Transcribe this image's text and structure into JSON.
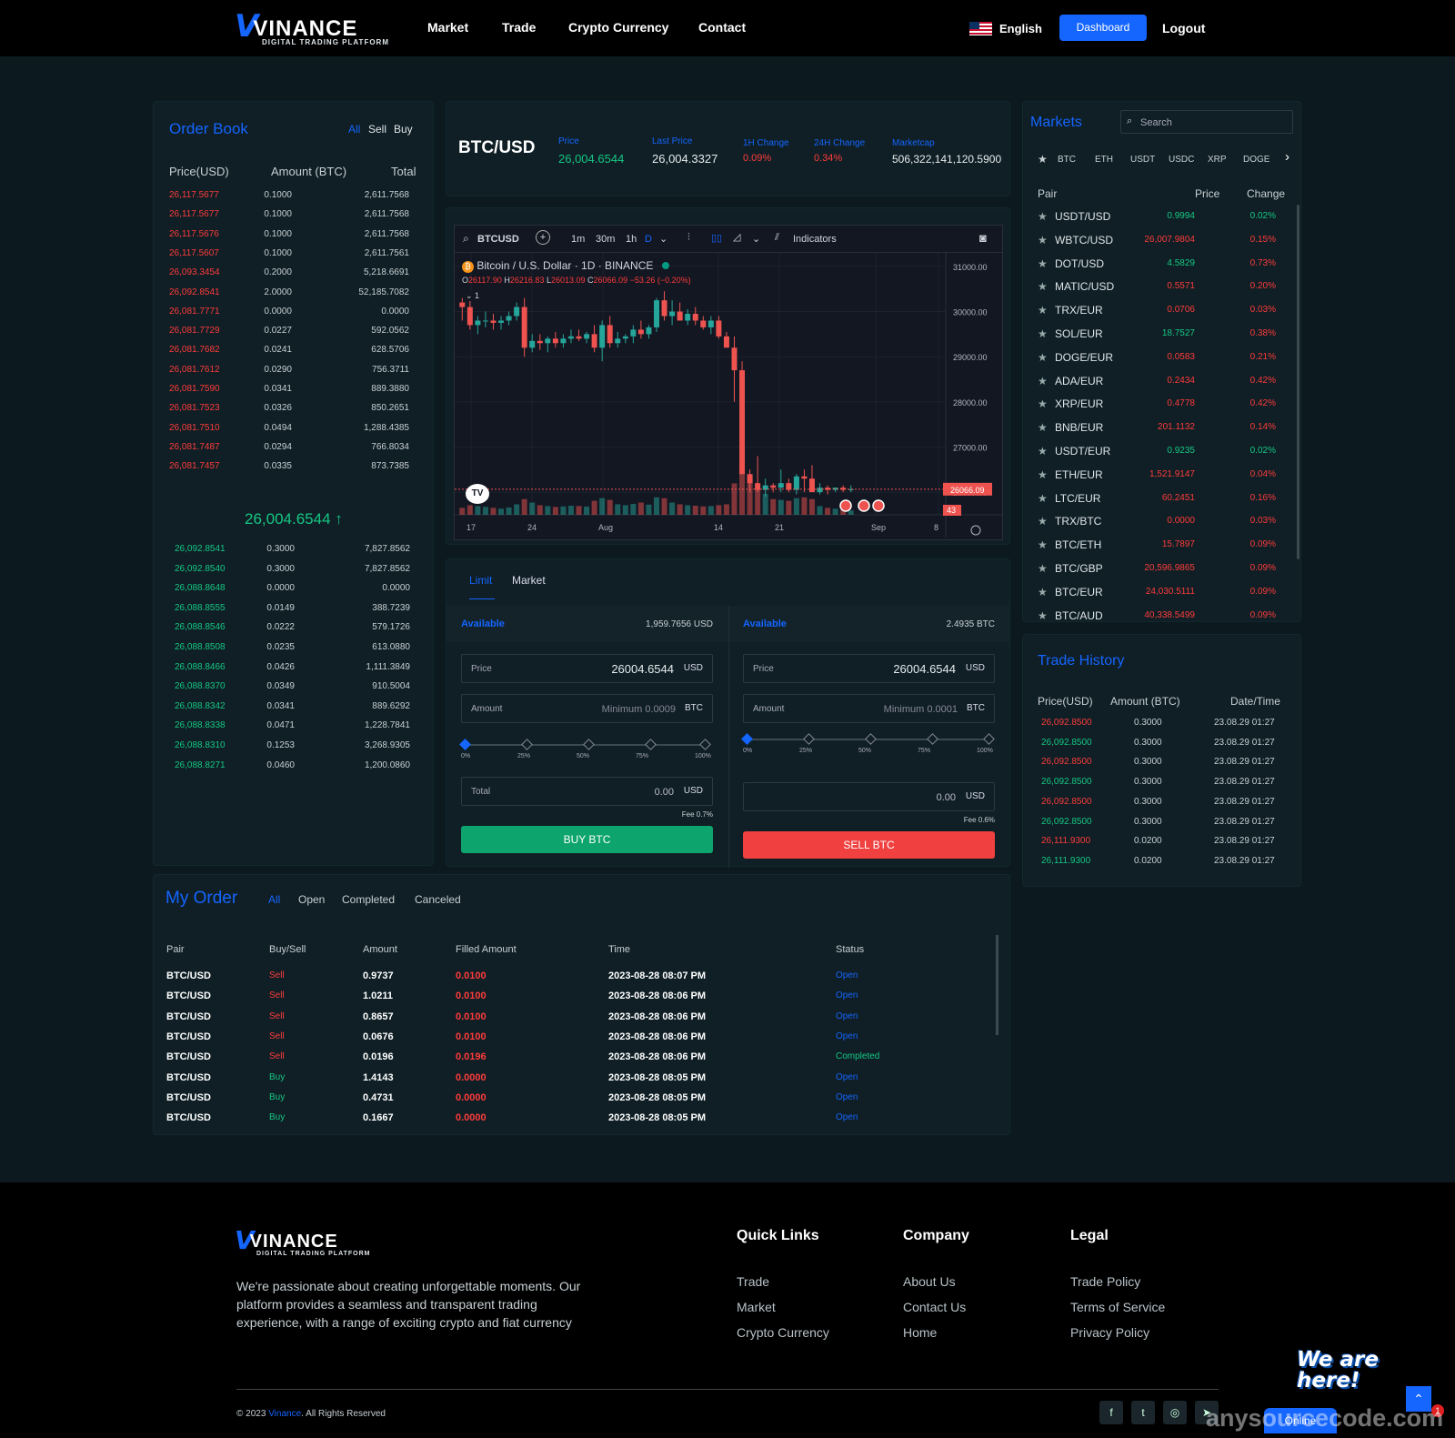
{
  "header": {
    "brand": "VINANCE",
    "brand_v": "V",
    "brand_tag": "DIGITAL TRADING PLATFORM",
    "nav": [
      "Market",
      "Trade",
      "Crypto Currency",
      "Contact"
    ],
    "language": "English",
    "dashboard": "Dashboard",
    "logout": "Logout"
  },
  "orderbook": {
    "title": "Order Book",
    "filters": [
      "All",
      "Sell",
      "Buy"
    ],
    "cols": [
      "Price(USD)",
      "Amount (BTC)",
      "Total"
    ],
    "sells": [
      [
        "26,117.5677",
        "0.1000",
        "2,611.7568"
      ],
      [
        "26,117.5677",
        "0.1000",
        "2,611.7568"
      ],
      [
        "26,117.5676",
        "0.1000",
        "2,611.7568"
      ],
      [
        "26,117.5607",
        "0.1000",
        "2,611.7561"
      ],
      [
        "26,093.3454",
        "0.2000",
        "5,218.6691"
      ],
      [
        "26,092.8541",
        "2.0000",
        "52,185.7082"
      ],
      [
        "26,081.7771",
        "0.0000",
        "0.0000"
      ],
      [
        "26,081.7729",
        "0.0227",
        "592.0562"
      ],
      [
        "26,081.7682",
        "0.0241",
        "628.5706"
      ],
      [
        "26,081.7612",
        "0.0290",
        "756.3711"
      ],
      [
        "26,081.7590",
        "0.0341",
        "889.3880"
      ],
      [
        "26,081.7523",
        "0.0326",
        "850.2651"
      ],
      [
        "26,081.7510",
        "0.0494",
        "1,288.4385"
      ],
      [
        "26,081.7487",
        "0.0294",
        "766.8034"
      ],
      [
        "26,081.7457",
        "0.0335",
        "873.7385"
      ]
    ],
    "mid": "26,004.6544",
    "buys": [
      [
        "26,092.8541",
        "0.3000",
        "7,827.8562"
      ],
      [
        "26,092.8540",
        "0.3000",
        "7,827.8562"
      ],
      [
        "26,088.8648",
        "0.0000",
        "0.0000"
      ],
      [
        "26,088.8555",
        "0.0149",
        "388.7239"
      ],
      [
        "26,088.8546",
        "0.0222",
        "579.1726"
      ],
      [
        "26,088.8508",
        "0.0235",
        "613.0880"
      ],
      [
        "26,088.8466",
        "0.0426",
        "1,111.3849"
      ],
      [
        "26,088.8370",
        "0.0349",
        "910.5004"
      ],
      [
        "26,088.8342",
        "0.0341",
        "889.6292"
      ],
      [
        "26,088.8338",
        "0.0471",
        "1,228.7841"
      ],
      [
        "26,088.8310",
        "0.1253",
        "3,268.9305"
      ],
      [
        "26,088.8271",
        "0.0460",
        "1,200.0860"
      ]
    ]
  },
  "ticker": {
    "pair": "BTC/USD",
    "price_label": "Price",
    "price": "26,004.6544",
    "last_label": "Last Price",
    "last": "26,004.3327",
    "h1_label": "1H Change",
    "h1": "0.09%",
    "h24_label": "24H Change",
    "h24": "0.34%",
    "mcap_label": "Marketcap",
    "mcap": "506,322,141,120.5900"
  },
  "chart_toolbar": {
    "symbol": "BTCUSD",
    "intervals": [
      "1m",
      "30m",
      "1h",
      "D"
    ],
    "indicators": "Indicators"
  },
  "chart_legend": {
    "title": "Bitcoin / U.S. Dollar · 1D · BINANCE",
    "o_label": "O",
    "o": "26117.90",
    "h_label": "H",
    "h": "26216.83",
    "l_label": "L",
    "l": "26013.09",
    "c_label": "C",
    "c": "26066.09",
    "chg": "−53.26 (−0.20%)",
    "collapse": "1"
  },
  "chart_data": {
    "type": "candlestick",
    "x_labels": [
      "17",
      "24",
      "Aug",
      "14",
      "21",
      "Sep",
      "8"
    ],
    "y_ticks": [
      "31000.00",
      "30000.00",
      "29000.00",
      "28000.00",
      "27000.00",
      "26000.00"
    ],
    "ylim": [
      25700,
      31300
    ],
    "last_price_label": "26066.09",
    "volume_label": "43",
    "candles": [
      [
        30200,
        30300,
        29800,
        30100
      ],
      [
        30100,
        30400,
        29600,
        29700
      ],
      [
        29700,
        29900,
        29500,
        29800
      ],
      [
        29800,
        30000,
        29650,
        29800
      ],
      [
        29800,
        29950,
        29600,
        29750
      ],
      [
        29750,
        29900,
        29600,
        29800
      ],
      [
        29800,
        30000,
        29700,
        29900
      ],
      [
        29900,
        30200,
        29800,
        30100
      ],
      [
        30100,
        30300,
        29000,
        29200
      ],
      [
        29200,
        29500,
        29100,
        29350
      ],
      [
        29350,
        29500,
        29150,
        29300
      ],
      [
        29300,
        29450,
        29100,
        29400
      ],
      [
        29400,
        29550,
        29200,
        29300
      ],
      [
        29300,
        29500,
        29200,
        29400
      ],
      [
        29400,
        29600,
        29300,
        29450
      ],
      [
        29450,
        29600,
        29350,
        29400
      ],
      [
        29400,
        29550,
        29300,
        29500
      ],
      [
        29500,
        29700,
        29100,
        29200
      ],
      [
        29200,
        29800,
        28900,
        29700
      ],
      [
        29700,
        29900,
        29200,
        29300
      ],
      [
        29300,
        29550,
        29200,
        29400
      ],
      [
        29400,
        29500,
        29300,
        29450
      ],
      [
        29450,
        29700,
        29300,
        29600
      ],
      [
        29600,
        29800,
        29400,
        29500
      ],
      [
        29500,
        29700,
        29400,
        29650
      ],
      [
        29650,
        30300,
        29550,
        30250
      ],
      [
        30250,
        30450,
        29800,
        29900
      ],
      [
        29900,
        30250,
        29700,
        30000
      ],
      [
        30000,
        30200,
        29800,
        29800
      ],
      [
        29800,
        30050,
        29700,
        29950
      ],
      [
        29950,
        30100,
        29700,
        29800
      ],
      [
        29800,
        29900,
        29600,
        29650
      ],
      [
        29650,
        29900,
        29500,
        29800
      ],
      [
        29800,
        29900,
        29400,
        29450
      ],
      [
        29450,
        29550,
        29300,
        29200
      ],
      [
        29200,
        29450,
        28000,
        28700
      ],
      [
        28700,
        28900,
        26800,
        26400
      ],
      [
        26400,
        26500,
        26000,
        26200
      ],
      [
        26200,
        26800,
        26000,
        26050
      ],
      [
        26050,
        26300,
        25900,
        26150
      ],
      [
        26150,
        26200,
        26000,
        26100
      ],
      [
        26100,
        26500,
        26000,
        26200
      ],
      [
        26200,
        26300,
        26000,
        26050
      ],
      [
        26050,
        26400,
        25950,
        26350
      ],
      [
        26350,
        26500,
        26000,
        26300
      ],
      [
        26300,
        26600,
        26000,
        26000
      ],
      [
        26000,
        26200,
        25950,
        26100
      ],
      [
        26100,
        26150,
        25950,
        26050
      ],
      [
        26050,
        26100,
        26000,
        26100
      ],
      [
        26100,
        26150,
        26000,
        26050
      ],
      [
        26050,
        26150,
        26000,
        26066
      ]
    ],
    "volumes": [
      40,
      55,
      50,
      45,
      40,
      35,
      42,
      60,
      90,
      70,
      55,
      50,
      45,
      48,
      52,
      50,
      47,
      80,
      95,
      85,
      60,
      55,
      62,
      70,
      58,
      100,
      95,
      70,
      60,
      55,
      52,
      48,
      50,
      55,
      60,
      180,
      260,
      200,
      150,
      120,
      90,
      85,
      80,
      95,
      100,
      90,
      50,
      40,
      35,
      30,
      25
    ]
  },
  "trade_form": {
    "tabs": [
      "Limit",
      "Market"
    ],
    "buy": {
      "available_label": "Available",
      "available": "1,959.7656 USD",
      "price_label": "Price",
      "price": "26004.6544",
      "price_unit": "USD",
      "amount_label": "Amount",
      "amount_ph": "Minimum 0.0009",
      "amount_unit": "BTC",
      "total_label": "Total",
      "total": "0.00",
      "total_unit": "USD",
      "fee": "Fee 0.7%",
      "button": "BUY BTC"
    },
    "sell": {
      "available_label": "Available",
      "available": "2.4935 BTC",
      "price_label": "Price",
      "price": "26004.6544",
      "price_unit": "USD",
      "amount_label": "Amount",
      "amount_ph": "Minimum 0.0001",
      "amount_unit": "BTC",
      "total": "0.00",
      "total_unit": "USD",
      "fee": "Fee 0.6%",
      "button": "SELL BTC"
    },
    "pcts": [
      "0%",
      "25%",
      "50%",
      "75%",
      "100%"
    ]
  },
  "markets": {
    "title": "Markets",
    "search_ph": "Search",
    "tabs": [
      "BTC",
      "ETH",
      "USDT",
      "USDC",
      "XRP",
      "DOGE"
    ],
    "cols": [
      "Pair",
      "Price",
      "Change"
    ],
    "rows": [
      [
        "USDT/USD",
        "0.9994",
        "0.02%",
        "green"
      ],
      [
        "WBTC/USD",
        "26,007.9804",
        "0.15%",
        "red"
      ],
      [
        "DOT/USD",
        "4.5829",
        "0.73%",
        "green"
      ],
      [
        "MATIC/USD",
        "0.5571",
        "0.20%",
        "red"
      ],
      [
        "TRX/EUR",
        "0.0706",
        "0.03%",
        "red"
      ],
      [
        "SOL/EUR",
        "18.7527",
        "0.38%",
        "green"
      ],
      [
        "DOGE/EUR",
        "0.0583",
        "0.21%",
        "red"
      ],
      [
        "ADA/EUR",
        "0.2434",
        "0.42%",
        "red"
      ],
      [
        "XRP/EUR",
        "0.4778",
        "0.42%",
        "red"
      ],
      [
        "BNB/EUR",
        "201.1132",
        "0.14%",
        "red"
      ],
      [
        "USDT/EUR",
        "0.9235",
        "0.02%",
        "green"
      ],
      [
        "ETH/EUR",
        "1,521.9147",
        "0.04%",
        "red"
      ],
      [
        "LTC/EUR",
        "60.2451",
        "0.16%",
        "red"
      ],
      [
        "TRX/BTC",
        "0.0000",
        "0.03%",
        "red"
      ],
      [
        "BTC/ETH",
        "15.7897",
        "0.09%",
        "red"
      ],
      [
        "BTC/GBP",
        "20,596.9865",
        "0.09%",
        "red"
      ],
      [
        "BTC/EUR",
        "24,030.5111",
        "0.09%",
        "red"
      ],
      [
        "BTC/AUD",
        "40,338.5499",
        "0.09%",
        "red"
      ]
    ]
  },
  "trade_history": {
    "title": "Trade History",
    "cols": [
      "Price(USD)",
      "Amount (BTC)",
      "Date/Time"
    ],
    "rows": [
      [
        "26,092.8500",
        "0.3000",
        "23.08.29 01:27",
        "red"
      ],
      [
        "26,092.8500",
        "0.3000",
        "23.08.29 01:27",
        "green"
      ],
      [
        "26,092.8500",
        "0.3000",
        "23.08.29 01:27",
        "red"
      ],
      [
        "26,092.8500",
        "0.3000",
        "23.08.29 01:27",
        "green"
      ],
      [
        "26,092.8500",
        "0.3000",
        "23.08.29 01:27",
        "red"
      ],
      [
        "26,092.8500",
        "0.3000",
        "23.08.29 01:27",
        "green"
      ],
      [
        "26,111.9300",
        "0.0200",
        "23.08.29 01:27",
        "red"
      ],
      [
        "26,111.9300",
        "0.0200",
        "23.08.29 01:27",
        "green"
      ]
    ]
  },
  "my_order": {
    "title": "My Order",
    "filters": [
      "All",
      "Open",
      "Completed",
      "Canceled"
    ],
    "cols": [
      "Pair",
      "Buy/Sell",
      "Amount",
      "Filled Amount",
      "Time",
      "Status"
    ],
    "rows": [
      [
        "BTC/USD",
        "Sell",
        "0.9737",
        "0.0100",
        "2023-08-28 08:07 PM",
        "Open"
      ],
      [
        "BTC/USD",
        "Sell",
        "1.0211",
        "0.0100",
        "2023-08-28 08:06 PM",
        "Open"
      ],
      [
        "BTC/USD",
        "Sell",
        "0.8657",
        "0.0100",
        "2023-08-28 08:06 PM",
        "Open"
      ],
      [
        "BTC/USD",
        "Sell",
        "0.0676",
        "0.0100",
        "2023-08-28 08:06 PM",
        "Open"
      ],
      [
        "BTC/USD",
        "Sell",
        "0.0196",
        "0.0196",
        "2023-08-28 08:06 PM",
        "Completed"
      ],
      [
        "BTC/USD",
        "Buy",
        "1.4143",
        "0.0000",
        "2023-08-28 08:05 PM",
        "Open"
      ],
      [
        "BTC/USD",
        "Buy",
        "0.4731",
        "0.0000",
        "2023-08-28 08:05 PM",
        "Open"
      ],
      [
        "BTC/USD",
        "Buy",
        "0.1667",
        "0.0000",
        "2023-08-28 08:05 PM",
        "Open"
      ]
    ]
  },
  "footer": {
    "about": "We're passionate about creating unforgettable moments. Our platform provides a seamless and transparent trading experience, with a range of exciting crypto and fiat currency",
    "quick_title": "Quick Links",
    "quick": [
      "Trade",
      "Market",
      "Crypto Currency"
    ],
    "company_title": "Company",
    "company": [
      "About Us",
      "Contact Us",
      "Home"
    ],
    "legal_title": "Legal",
    "legal": [
      "Trade Policy",
      "Terms of Service",
      "Privacy Policy"
    ],
    "copy_pre": "© 2023",
    "copy_brand": "Vinance",
    "copy_post": ". All Rights Reserved",
    "social": [
      "facebook-icon",
      "twitter-icon",
      "instagram-icon",
      "telegram-icon"
    ]
  },
  "chat": {
    "we_are_here": "We are here!",
    "online": "Online",
    "badge": "1"
  },
  "watermark": "anysourcecode.com",
  "colors": {
    "accent": "#1565ff",
    "up": "#16c784",
    "down": "#ff3b3b",
    "bg": "#0c1a1f",
    "panel": "#0f1f25"
  }
}
